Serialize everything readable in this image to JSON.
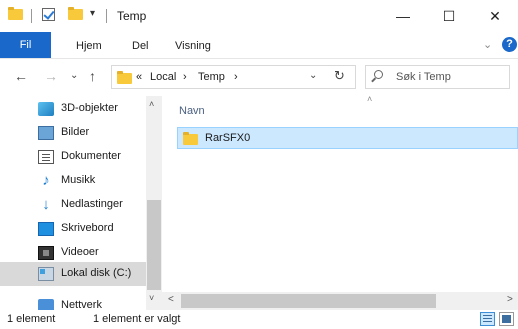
{
  "window": {
    "title": "Temp",
    "minimize": "—",
    "maximize": "☐",
    "close": "✕"
  },
  "quick_access": {
    "dropdown_arrow": "▾"
  },
  "ribbon": {
    "tabs": [
      "Fil",
      "Hjem",
      "Del",
      "Visning"
    ],
    "expand": "⌄",
    "help": "?"
  },
  "nav": {
    "back": "←",
    "forward": "→",
    "recent": "⌄",
    "up": "↑"
  },
  "address": {
    "overflow": "«",
    "segments": [
      "Local",
      "Temp"
    ],
    "separator": "›",
    "dropdown": "⌄",
    "refresh": "↻"
  },
  "search": {
    "placeholder": "Søk i Temp"
  },
  "navpane": {
    "items": [
      {
        "label": "3D-objekter",
        "icon": "3d-objects-icon"
      },
      {
        "label": "Bilder",
        "icon": "pictures-icon"
      },
      {
        "label": "Dokumenter",
        "icon": "documents-icon"
      },
      {
        "label": "Musikk",
        "icon": "music-icon"
      },
      {
        "label": "Nedlastinger",
        "icon": "downloads-icon"
      },
      {
        "label": "Skrivebord",
        "icon": "desktop-icon"
      },
      {
        "label": "Videoer",
        "icon": "videos-icon"
      },
      {
        "label": "Lokal disk (C:)",
        "icon": "local-disk-icon",
        "selected": true
      },
      {
        "label": "Nettverk",
        "icon": "network-icon"
      }
    ],
    "scroll_up": "˄",
    "scroll_down": "˅"
  },
  "content": {
    "column_header": "Navn",
    "sort_indicator": "˄",
    "files": [
      {
        "name": "RarSFX0",
        "type": "folder",
        "selected": true
      }
    ],
    "scroll_left": "<",
    "scroll_right": ">"
  },
  "status": {
    "count": "1 element",
    "selection": "1 element er valgt"
  },
  "colors": {
    "accent": "#1a68c9",
    "selection": "#cce8ff",
    "folder": "#f8c93a"
  }
}
